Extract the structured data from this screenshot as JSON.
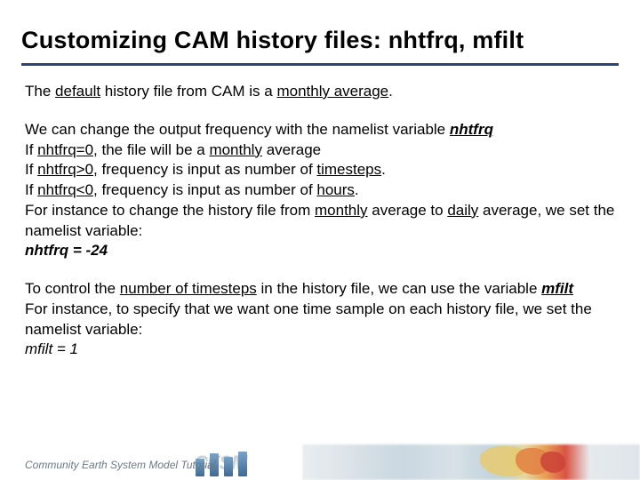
{
  "title": "Customizing CAM history files: nhtfrq, mfilt",
  "intro": {
    "pre": "The ",
    "default": "default",
    "mid": " history file from CAM is a ",
    "monthly_average": "monthly average",
    "post": "."
  },
  "block2": {
    "l1_pre": "We can change the output frequency with the namelist variable ",
    "l1_var": "nhtfrq",
    "l2_pre": "If ",
    "l2_cond": "nhtfrq=0",
    "l2_mid": ", the file will be a ",
    "l2_monthly": "monthly",
    "l2_post": " average",
    "l3_pre": "If ",
    "l3_cond": "nhtfrq>0",
    "l3_mid": ", frequency is input as number of ",
    "l3_timesteps": "timesteps",
    "l3_post": ".",
    "l4_pre": "If ",
    "l4_cond": "nhtfrq<0",
    "l4_mid": ", frequency is input as number of ",
    "l4_hours": "hours",
    "l4_post": ".",
    "l5_pre": "For instance to change the history file from ",
    "l5_monthly": "monthly",
    "l5_mid": " average to ",
    "l5_daily": "daily",
    "l5_post": " average, we set the namelist variable:",
    "l6_eq": "nhtfrq = -24"
  },
  "block3": {
    "l1_pre": "To control the ",
    "l1_num_ts": "number of timesteps",
    "l1_mid": " in the history file, we can use the variable ",
    "l1_var": "mfilt",
    "l2": "For instance, to specify that we want one time sample on each history file, we set the namelist variable:",
    "l3_eq": "mfilt = 1"
  },
  "footer": {
    "text": "Community Earth System Model Tutorial",
    "logo": "CESM"
  }
}
